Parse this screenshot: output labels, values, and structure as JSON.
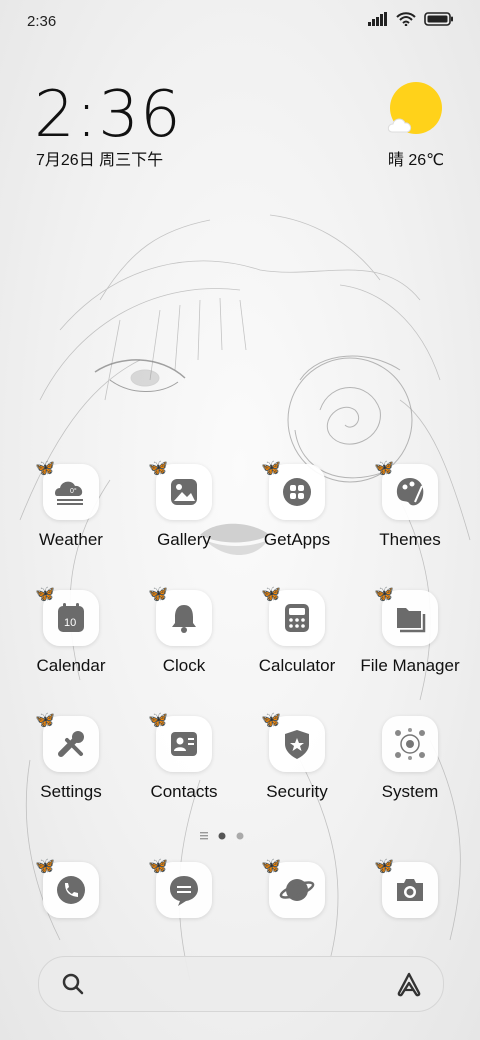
{
  "status_bar": {
    "time": "2:36"
  },
  "clock_widget": {
    "time": "2:36",
    "date": "7月26日 周三下午"
  },
  "weather_widget": {
    "text": "晴 26℃"
  },
  "apps": [
    {
      "label": "Weather",
      "icon": "weather-icon"
    },
    {
      "label": "Gallery",
      "icon": "gallery-icon"
    },
    {
      "label": "GetApps",
      "icon": "getapps-icon"
    },
    {
      "label": "Themes",
      "icon": "themes-icon"
    },
    {
      "label": "Calendar",
      "icon": "calendar-icon",
      "badge": "10"
    },
    {
      "label": "Clock",
      "icon": "clock-icon"
    },
    {
      "label": "Calculator",
      "icon": "calculator-icon"
    },
    {
      "label": "File Manager",
      "icon": "file-manager-icon"
    },
    {
      "label": "Settings",
      "icon": "settings-icon"
    },
    {
      "label": "Contacts",
      "icon": "contacts-icon"
    },
    {
      "label": "Security",
      "icon": "security-icon"
    },
    {
      "label": "System",
      "icon": "system-folder-icon"
    }
  ],
  "weather_app": {
    "glyph_text": "0°"
  },
  "dock": [
    {
      "icon": "phone-icon"
    },
    {
      "icon": "messages-icon"
    },
    {
      "icon": "browser-icon"
    },
    {
      "icon": "camera-icon"
    }
  ],
  "colors": {
    "sun": "#ffd21a",
    "icon_gray": "#6b6b6b"
  }
}
